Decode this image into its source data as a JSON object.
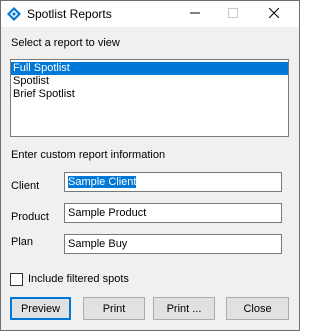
{
  "window": {
    "title": "Spotlist Reports",
    "icon": "app-diamond-icon",
    "accent_color": "#0078d7"
  },
  "report_section": {
    "label": "Select a report to view",
    "items": [
      "Full Spotlist",
      "Spotlist",
      "Brief Spotlist"
    ],
    "selected": "Full Spotlist"
  },
  "custom_section": {
    "label": "Enter custom report information",
    "fields": [
      {
        "label": "Client",
        "value": "Sample Client"
      },
      {
        "label": "Product",
        "value": "Sample Product"
      },
      {
        "label": "Plan",
        "value": "Sample Buy"
      }
    ]
  },
  "filter": {
    "label": "Include filtered spots",
    "checked": false
  },
  "buttons": {
    "preview": "Preview",
    "print": "Print",
    "print_dialog": "Print ...",
    "close": "Close"
  }
}
